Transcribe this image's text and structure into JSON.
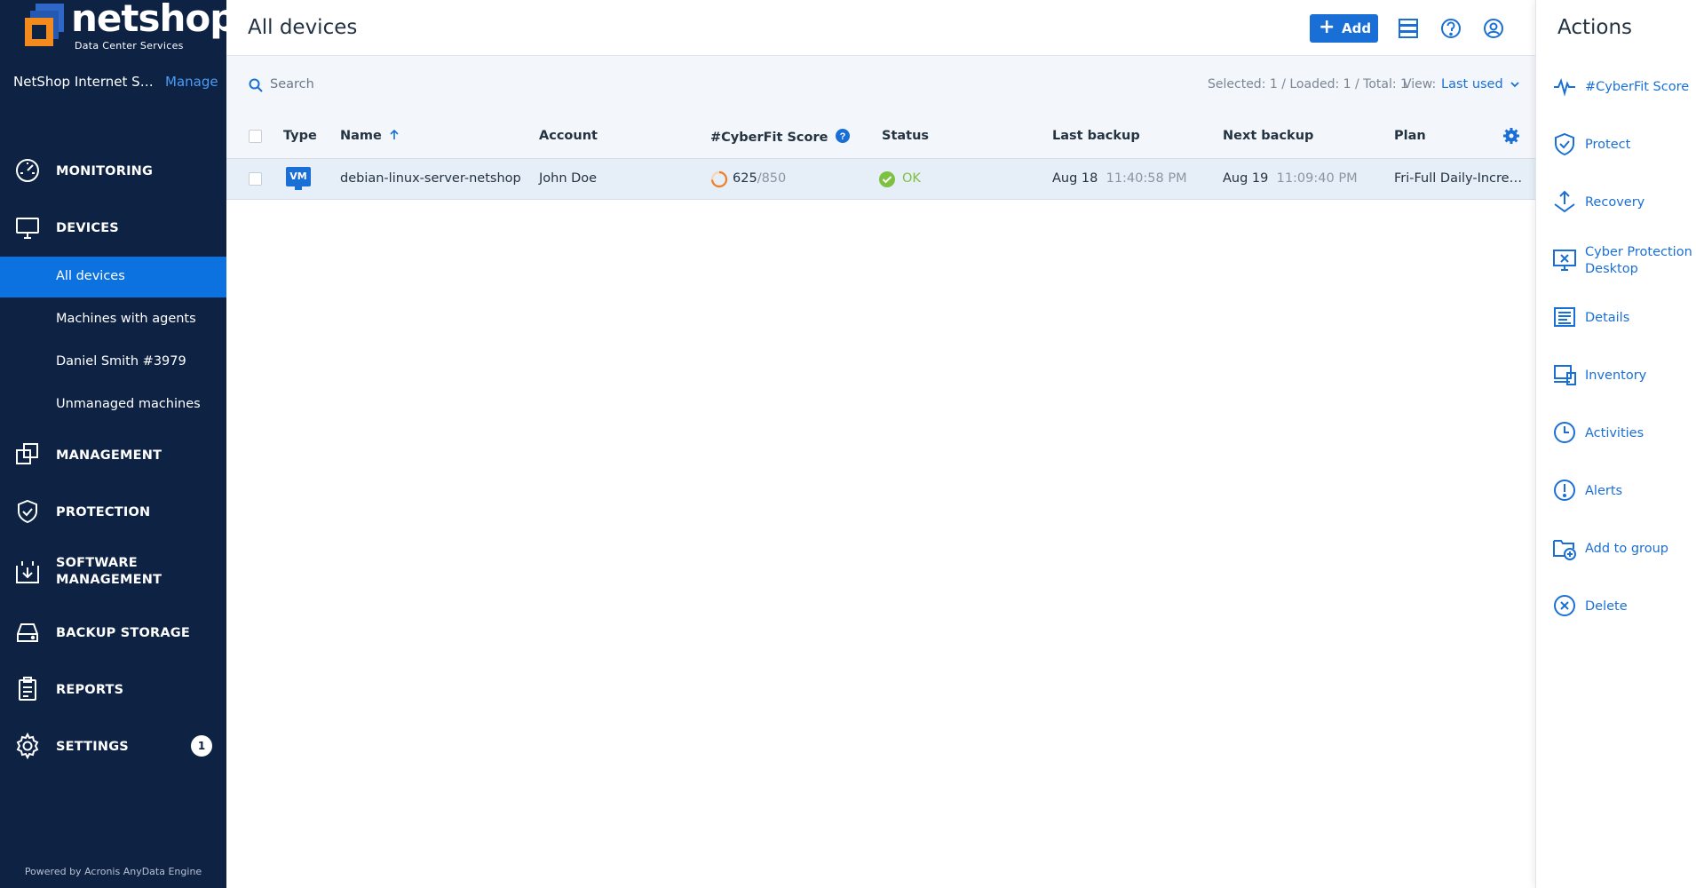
{
  "brand": {
    "name": "netshop",
    "tagline": "Data Center Services",
    "colors": {
      "sidebar": "#0e2244",
      "accent": "#1a6fd6",
      "active": "#0c72e0",
      "ok": "#7dc142",
      "score_ring": "#f07e26",
      "logo_orange": "#f28a1d"
    }
  },
  "tenant": {
    "name": "NetShop Internet Services",
    "manage_label": "Manage"
  },
  "sidebar": {
    "monitoring": {
      "label": "MONITORING",
      "icon": "gauge-icon"
    },
    "devices": {
      "label": "DEVICES",
      "icon": "monitor-icon",
      "subitems": [
        {
          "label": "All devices",
          "active": true
        },
        {
          "label": "Machines with agents"
        },
        {
          "label": "Daniel Smith #3979"
        },
        {
          "label": "Unmanaged machines"
        }
      ]
    },
    "management": {
      "label": "MANAGEMENT",
      "icon": "copy-icon"
    },
    "protection": {
      "label": "PROTECTION",
      "icon": "shield-check-icon"
    },
    "software_management": {
      "label_line1": "SOFTWARE",
      "label_line2": "MANAGEMENT",
      "icon": "software-download-icon"
    },
    "backup_storage": {
      "label": "BACKUP STORAGE",
      "icon": "hard-drive-icon"
    },
    "reports": {
      "label": "REPORTS",
      "icon": "clipboard-icon"
    },
    "settings": {
      "label": "SETTINGS",
      "icon": "gear-icon",
      "badge": "1"
    },
    "powered_by": "Powered by Acronis AnyData Engine"
  },
  "header": {
    "title": "All devices",
    "add_label": "Add"
  },
  "toolbar": {
    "search_placeholder": "Search",
    "counts": "Selected: 1 / Loaded: 1 / Total: 1",
    "view_label": "View:",
    "view_value": "Last used"
  },
  "table": {
    "columns": {
      "type": "Type",
      "name": "Name",
      "account": "Account",
      "cyberfit": "#CyberFit Score",
      "status": "Status",
      "last_backup": "Last backup",
      "next_backup": "Next backup",
      "plan": "Plan"
    },
    "rows": [
      {
        "type": "VM",
        "name": "debian-linux-server-netshop",
        "account": "John Doe",
        "score": "625",
        "score_max": "/850",
        "score_fraction": 0.735,
        "status": "OK",
        "last_backup_date": "Aug 18",
        "last_backup_time": "11:40:58 PM",
        "next_backup_date": "Aug 19",
        "next_backup_time": "11:09:40 PM",
        "plan": "Fri-Full Daily-Incremental"
      }
    ]
  },
  "actions": {
    "title": "Actions",
    "items": [
      {
        "label": "#CyberFit Score",
        "icon": "pulse-icon"
      },
      {
        "label": "Protect",
        "icon": "shield-check-icon"
      },
      {
        "label": "Recovery",
        "icon": "recovery-icon"
      },
      {
        "label_line1": "Cyber Protection",
        "label_line2": "Desktop",
        "icon": "remote-desktop-icon"
      },
      {
        "label": "Details",
        "icon": "details-icon"
      },
      {
        "label": "Inventory",
        "icon": "inventory-icon"
      },
      {
        "label": "Activities",
        "icon": "clock-icon"
      },
      {
        "label": "Alerts",
        "icon": "alert-icon"
      },
      {
        "label": "Add to group",
        "icon": "folder-add-icon"
      },
      {
        "label": "Delete",
        "icon": "delete-icon"
      }
    ]
  }
}
